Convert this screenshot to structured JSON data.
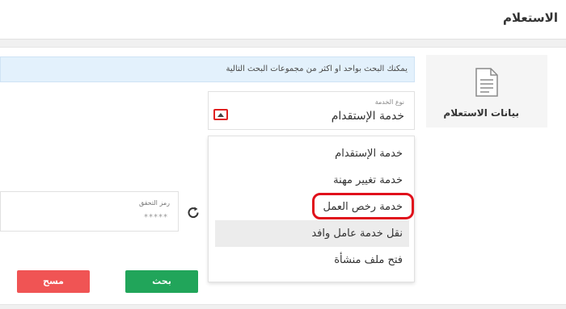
{
  "header": {
    "title": "الاستعلام"
  },
  "sidebar": {
    "icon": "document-icon",
    "label": "بيانات الاستعلام"
  },
  "info": {
    "text": "يمكنك البحث بواحد او اكثر من مجموعات البحث التالية"
  },
  "service_select": {
    "label": "نوع الخدمة",
    "value": "خدمة الإستقدام",
    "options": [
      "خدمة الإستقدام",
      "خدمة تغيير مهنة",
      "خدمة رخص العمل",
      "نقل خدمة عامل وافد",
      "فتح ملف منشأة"
    ]
  },
  "captcha": {
    "label": "رمز التحقق",
    "placeholder": "*****"
  },
  "buttons": {
    "search": "بحث",
    "clear": "مسح"
  },
  "colors": {
    "search_button": "#21a55a",
    "clear_button": "#f05454",
    "highlight": "#e0101b",
    "info_background": "#e3f1fc"
  }
}
